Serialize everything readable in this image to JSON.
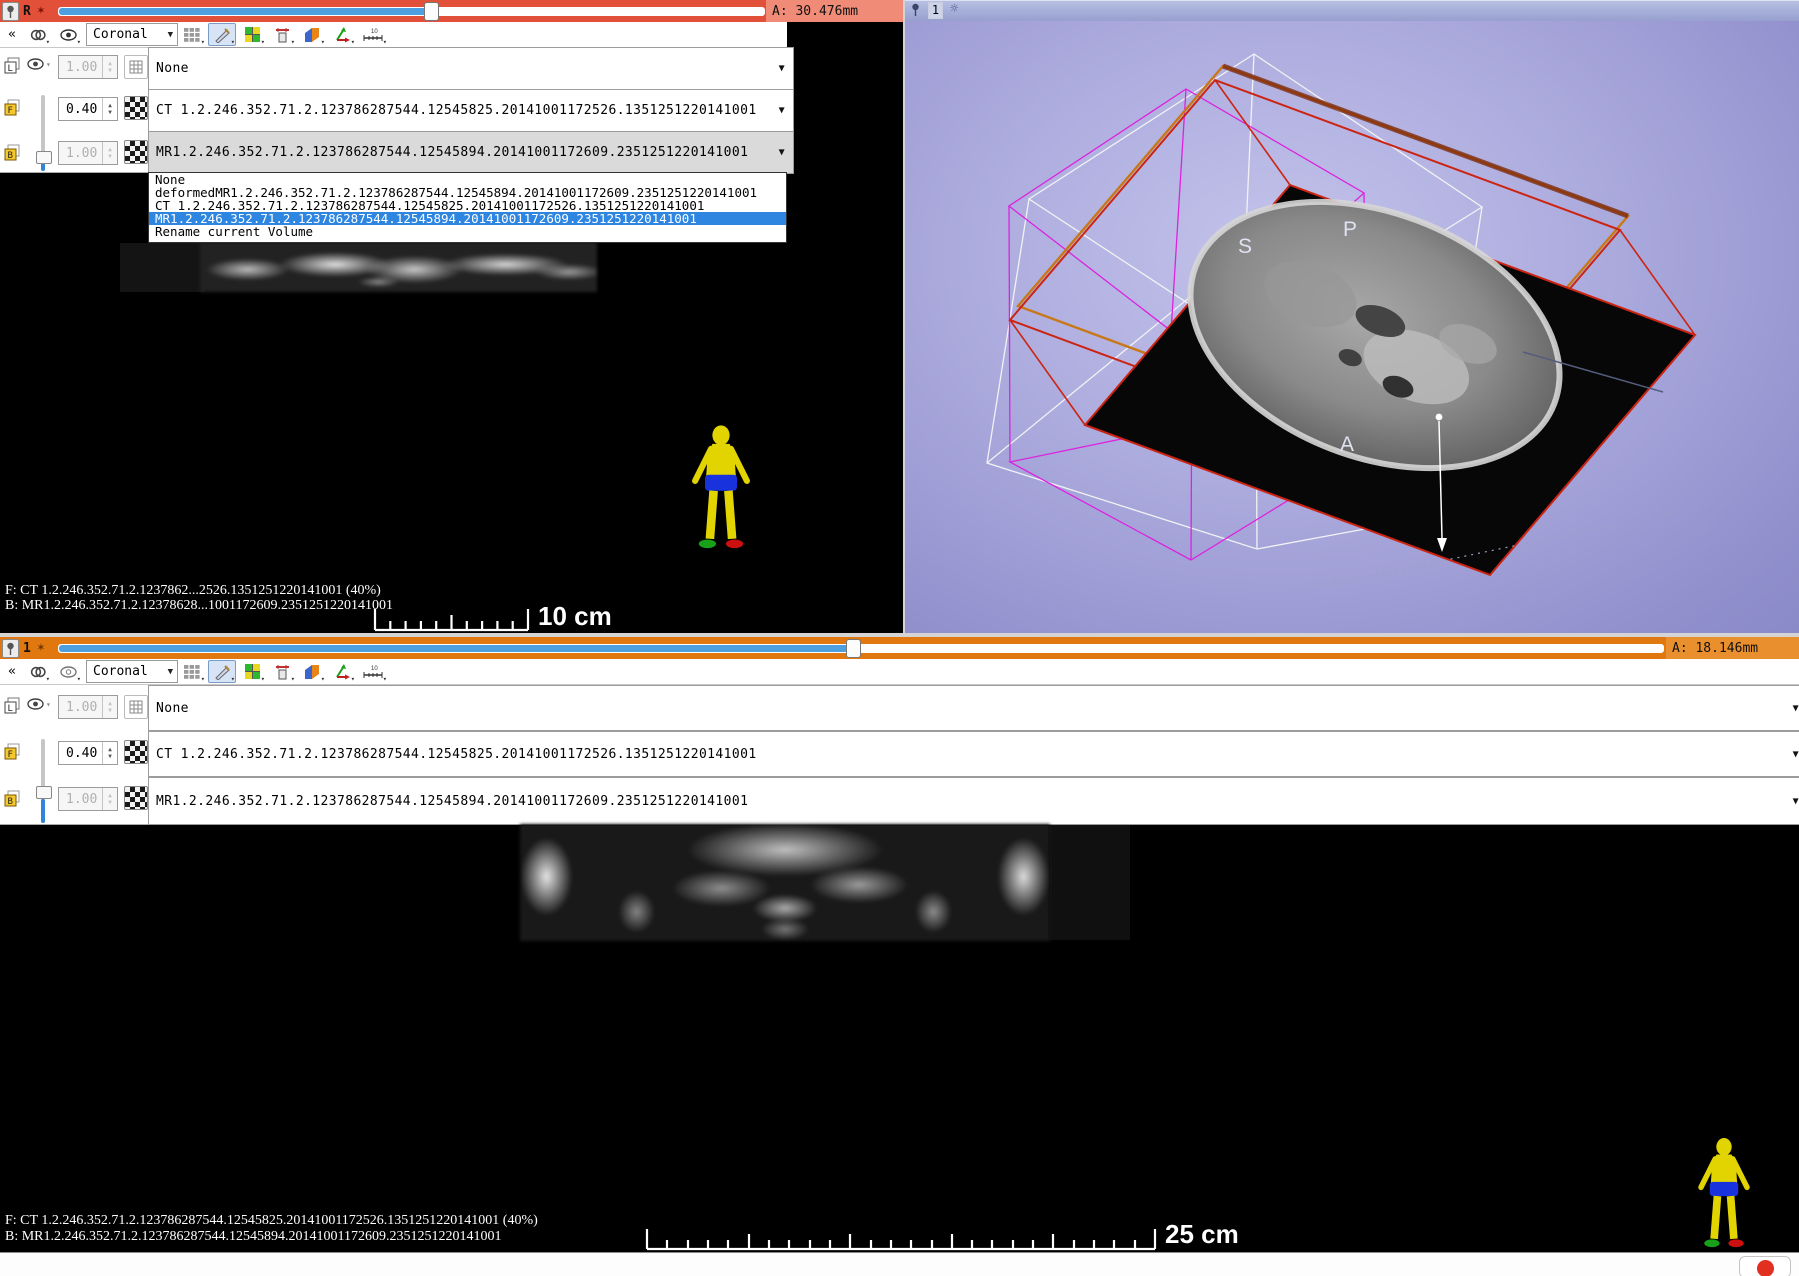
{
  "red_viewer": {
    "name_label": "R",
    "offset_label": "A: 30.476mm",
    "toolbar": {
      "orientation": "Coronal"
    },
    "rows": {
      "label": {
        "value": "None",
        "opacity": "1.00"
      },
      "foreground": {
        "value": "CT 1.2.246.352.71.2.123786287544.12545825.20141001172526.1351251220141001",
        "opacity": "0.40"
      },
      "background": {
        "value": "MR1.2.246.352.71.2.123786287544.12545894.20141001172609.2351251220141001",
        "opacity": "1.00"
      }
    },
    "dropdown": {
      "items": [
        "None",
        "deformedMR1.2.246.352.71.2.123786287544.12545894.20141001172609.2351251220141001",
        "CT 1.2.246.352.71.2.123786287544.12545825.20141001172526.1351251220141001",
        "MR1.2.246.352.71.2.123786287544.12545894.20141001172609.2351251220141001",
        "Rename current Volume"
      ],
      "selected": "MR1.2.246.352.71.2.123786287544.12545894.20141001172609.2351251220141001"
    },
    "overlay": {
      "line_f": "F: CT 1.2.246.352.71.2.1237862...2526.1351251220141001 (40%)",
      "line_b": "B: MR1.2.246.352.71.2.12378628...1001172609.2351251220141001",
      "scale": "10 cm"
    }
  },
  "view3d": {
    "name_label": "1",
    "labels": {
      "s": "S",
      "p": "P",
      "a": "A"
    }
  },
  "orange_viewer": {
    "name_label": "1",
    "offset_label": "A: 18.146mm",
    "toolbar": {
      "orientation": "Coronal"
    },
    "rows": {
      "label": {
        "value": "None",
        "opacity": "1.00"
      },
      "foreground": {
        "value": "CT 1.2.246.352.71.2.123786287544.12545825.20141001172526.1351251220141001",
        "opacity": "0.40"
      },
      "background": {
        "value": "MR1.2.246.352.71.2.123786287544.12545894.20141001172609.2351251220141001",
        "opacity": "1.00"
      }
    },
    "overlay": {
      "line_f": "F: CT 1.2.246.352.71.2.123786287544.12545825.20141001172526.1351251220141001 (40%)",
      "line_b": "B: MR1.2.246.352.71.2.123786287544.12545894.20141001172609.2351251220141001",
      "scale": "25 cm"
    }
  },
  "icons": {
    "chevrons_collapse": "«",
    "star": "✶",
    "sun": "☼",
    "ruler_ten": "10"
  },
  "colors": {
    "red_bar": "#e2503a",
    "red_bar_light": "#ef8b76",
    "orange_bar": "#e0780f",
    "orange_bar_light": "#e98f2e",
    "slider_fill": "#4d9fe0",
    "menu_highlight": "#2e86e0",
    "magenta_wire": "#dd22dd",
    "slab_orange": "#c87818",
    "slab_red": "#cc2412",
    "bg3d_light": "#c3c3eb",
    "bg3d_dark": "#8a8ac8"
  }
}
